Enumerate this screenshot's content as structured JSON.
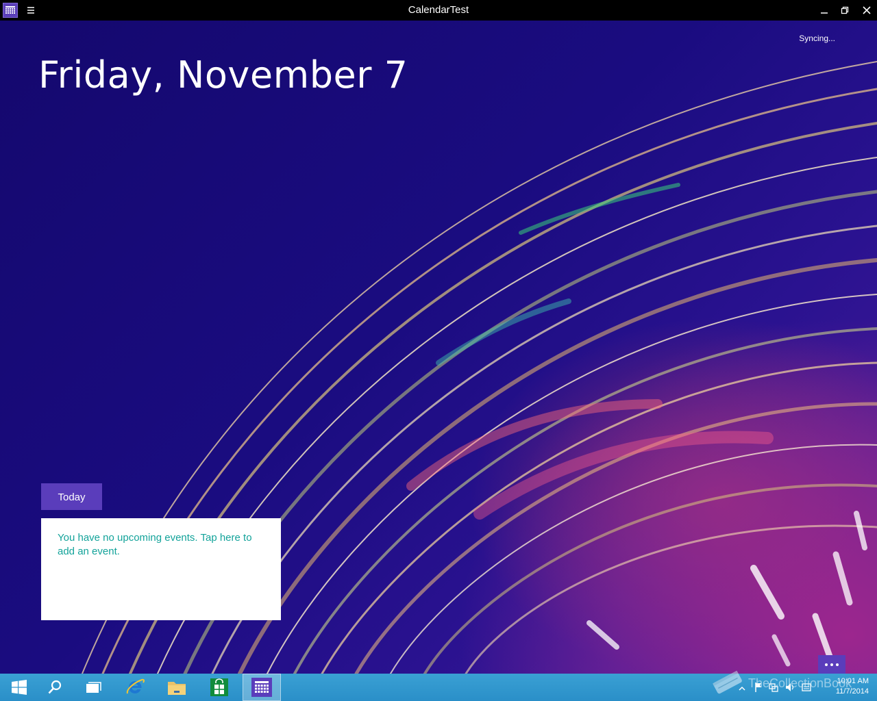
{
  "window": {
    "title": "CalendarTest"
  },
  "status": {
    "sync_text": "Syncing..."
  },
  "main": {
    "date_heading": "Friday, November 7",
    "today_button_label": "Today",
    "no_events_message": "You have no upcoming events. Tap here to add an event.",
    "more_button_label": "..."
  },
  "colors": {
    "accent": "#5a3dbb",
    "event_text": "#13a39a",
    "taskbar": "#2a8fc8",
    "titlebar": "#000000"
  },
  "taskbar": {
    "items": [
      {
        "name": "start",
        "icon": "windows-logo-icon"
      },
      {
        "name": "search",
        "icon": "search-icon"
      },
      {
        "name": "task-view",
        "icon": "task-view-icon"
      },
      {
        "name": "internet-explorer",
        "icon": "internet-explorer-icon"
      },
      {
        "name": "file-explorer",
        "icon": "folder-icon"
      },
      {
        "name": "store",
        "icon": "store-icon"
      },
      {
        "name": "calendar-test",
        "icon": "calendar-icon"
      }
    ],
    "clock_time": "10:01 AM",
    "clock_date": "11/7/2014",
    "watermark": "TheCollectionBook"
  }
}
